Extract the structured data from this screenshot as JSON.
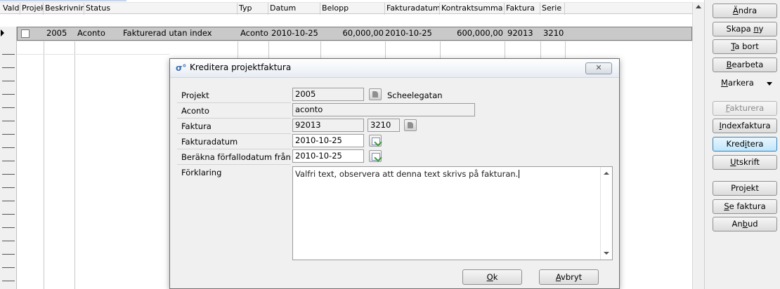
{
  "grid": {
    "columns": [
      "Vald",
      "Projekt",
      "Beskrivning",
      "Status",
      "Typ",
      "Datum",
      "Belopp",
      "Fakturadatum",
      "Kontraktsumma",
      "Faktura",
      "Serie"
    ],
    "selected_row": {
      "projekt": "2005",
      "beskrivning": "Aconto",
      "status": "Fakturerad utan index",
      "typ": "Aconto",
      "datum": "2010-10-25",
      "belopp": "60,000,00",
      "fakturadatum": "2010-10-25",
      "kontraktsumma": "600,000,00",
      "faktura": "92013",
      "serie": "3210"
    }
  },
  "buttons": {
    "andra": {
      "label": "Ändra",
      "hotkey": "Ä"
    },
    "skapa_ny": {
      "pre": "Skapa ",
      "hot": "n",
      "post": "y"
    },
    "ta_bort": {
      "pre": "",
      "hot": "T",
      "post": "a bort"
    },
    "bearbeta": {
      "pre": "",
      "hot": "B",
      "post": "earbeta"
    },
    "markera": {
      "pre": "",
      "hot": "M",
      "post": "arkera"
    },
    "fakturera": {
      "pre": "",
      "hot": "F",
      "post": "akturera"
    },
    "indexfaktura": {
      "pre": "",
      "hot": "I",
      "post": "ndexfaktura"
    },
    "kreditera": {
      "pre": "Kred",
      "hot": "i",
      "post": "tera"
    },
    "utskrift": {
      "pre": "",
      "hot": "U",
      "post": "tskrift"
    },
    "projekt": {
      "pre": "Pro",
      "hot": "j",
      "post": "ekt"
    },
    "se_faktura": {
      "pre": "",
      "hot": "S",
      "post": "e faktura"
    },
    "anbud": {
      "pre": "An",
      "hot": "b",
      "post": "ud"
    }
  },
  "dialog": {
    "title": "Kreditera projektfaktura",
    "close_icon": "x-icon",
    "fields": {
      "projekt": {
        "label": "Projekt",
        "value": "2005",
        "name": "Scheelegatan"
      },
      "aconto": {
        "label": "Aconto",
        "value": "aconto"
      },
      "faktura": {
        "label": "Faktura",
        "value": "92013",
        "serie": "3210"
      },
      "fakturadatum": {
        "label": "Fakturadatum",
        "value": "2010-10-25"
      },
      "forfallodatum": {
        "label": "Beräkna förfallodatum från",
        "value": "2010-10-25"
      },
      "forklaring": {
        "label": "Förklaring",
        "value": "Valfri text, observera att denna text skrivs på fakturan."
      }
    },
    "ok": {
      "hot": "O",
      "post": "k"
    },
    "avbryt": {
      "hot": "A",
      "post": "vbryt"
    }
  }
}
